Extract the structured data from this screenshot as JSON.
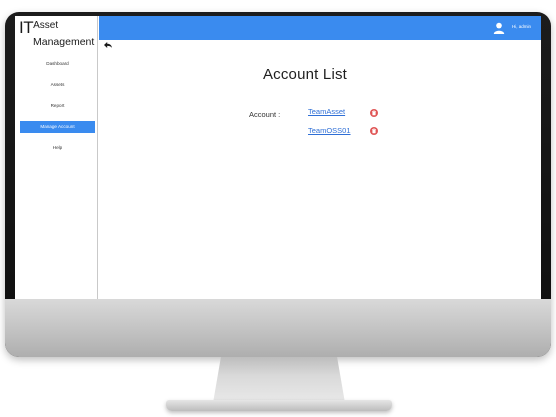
{
  "app": {
    "logo_it": "IT",
    "logo_asset": "Asset",
    "logo_management": "Management"
  },
  "sidebar": {
    "items": [
      {
        "label": "Dashboard",
        "active": false
      },
      {
        "label": "Assets",
        "active": false
      },
      {
        "label": "Report",
        "active": false
      },
      {
        "label": "Manage Account",
        "active": true
      },
      {
        "label": "Help",
        "active": false
      }
    ]
  },
  "header": {
    "greeting": "Hi, admin",
    "user_icon": "user-icon"
  },
  "main": {
    "back_icon": "back-arrow-icon",
    "title": "Account List",
    "account_label": "Account :",
    "accounts": [
      {
        "name": "TeamAsset",
        "delete_icon": "delete-icon"
      },
      {
        "name": "TeamOSS01",
        "delete_icon": "delete-icon"
      }
    ]
  },
  "colors": {
    "accent": "#3a8bef",
    "link": "#2f6fd6",
    "delete": "#e05656"
  }
}
